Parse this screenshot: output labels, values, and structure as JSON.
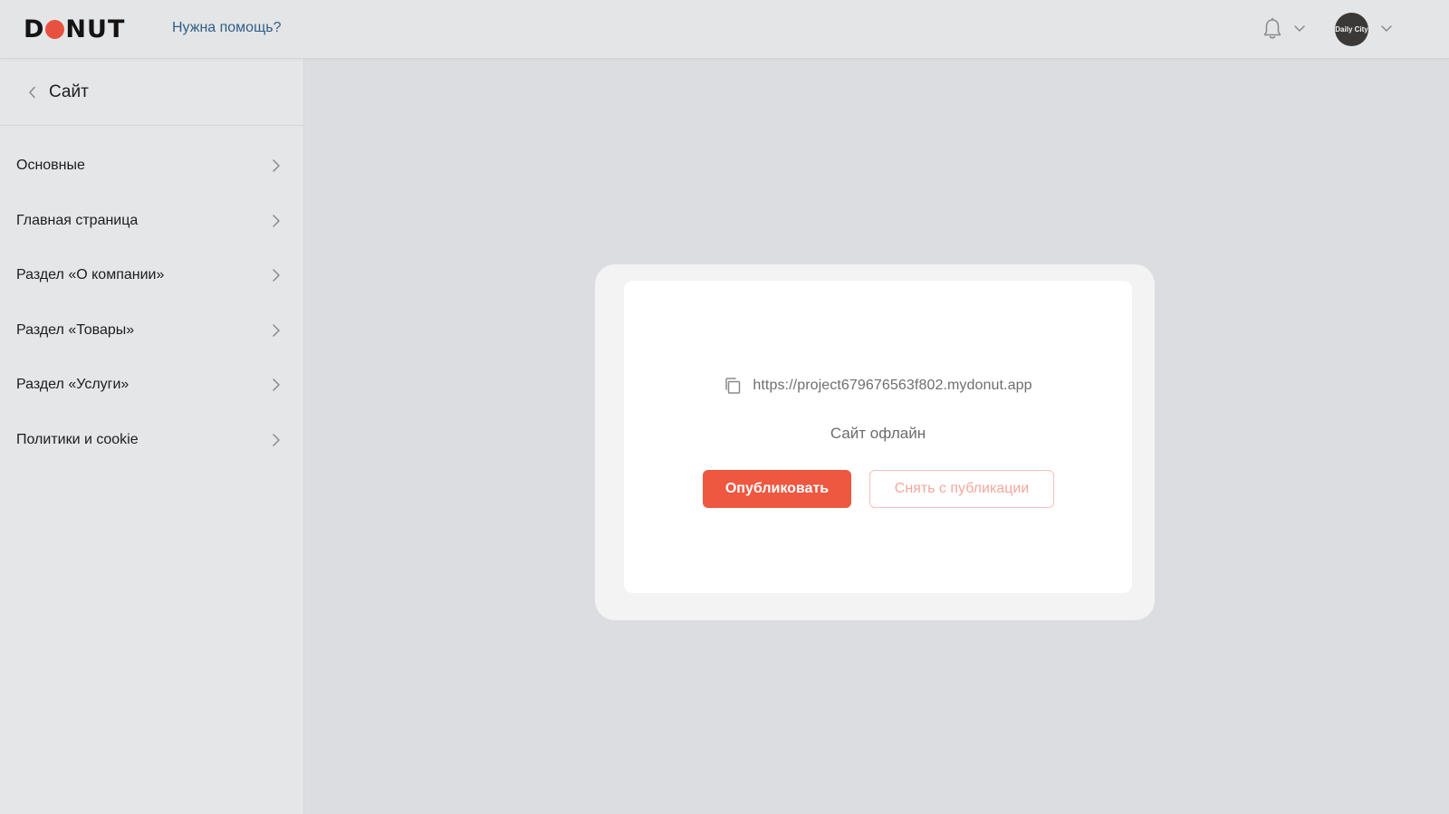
{
  "header": {
    "logo_text": "DONUT",
    "help_link": "Нужна помощь?",
    "avatar_text": "Daily City"
  },
  "sidebar": {
    "title": "Сайт",
    "items": [
      {
        "label": "Основные"
      },
      {
        "label": "Главная страница"
      },
      {
        "label": "Раздел «О компании»"
      },
      {
        "label": "Раздел «Товары»"
      },
      {
        "label": "Раздел «Услуги»"
      },
      {
        "label": "Политики и cookie"
      }
    ]
  },
  "card": {
    "url": "https://project679676563f802.mydonut.app",
    "status": "Сайт офлайн",
    "publish_label": "Опубликовать",
    "unpublish_label": "Снять с публикации"
  },
  "colors": {
    "accent": "#ee5740",
    "link": "#2f5f86"
  },
  "icons": [
    "bell-icon",
    "chevron-down-icon",
    "chevron-left-icon",
    "chevron-right-icon",
    "copy-icon"
  ]
}
